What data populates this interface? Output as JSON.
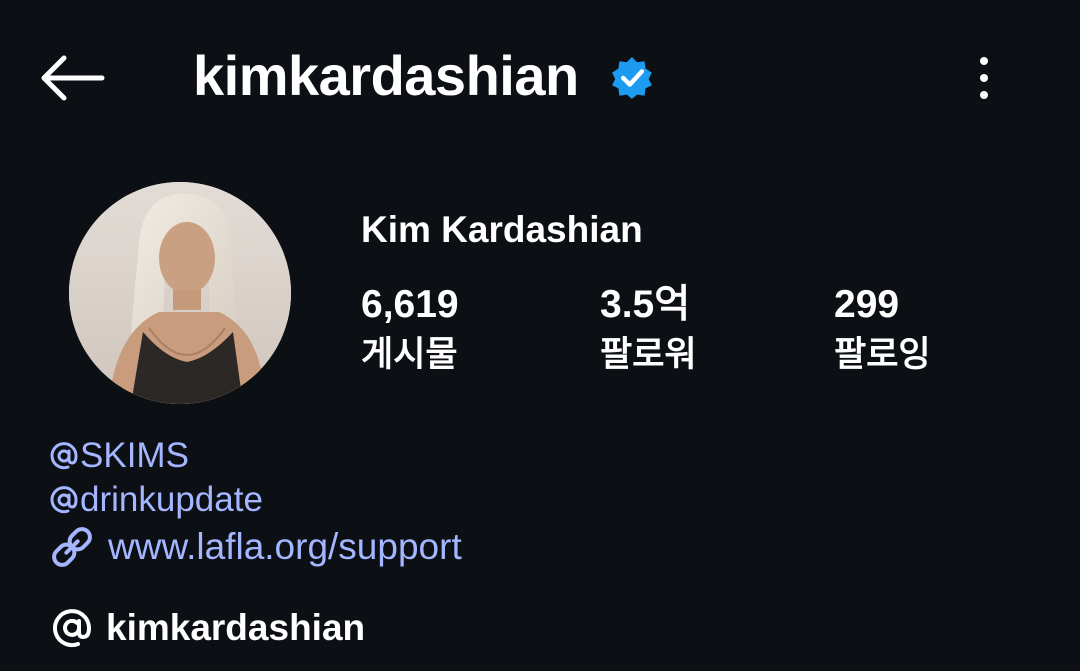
{
  "header": {
    "username": "kimkardashian",
    "back_icon": "arrow-left-icon",
    "verified_icon": "verified-badge-icon",
    "verified_color": "#1d9bf0",
    "more_icon": "more-vertical-icon"
  },
  "profile": {
    "display_name": "Kim Kardashian",
    "avatar": "profile-photo"
  },
  "stats": [
    {
      "value": "6,619",
      "label": "게시물"
    },
    {
      "value": "3.5억",
      "label": "팔로워"
    },
    {
      "value": "299",
      "label": "팔로잉"
    }
  ],
  "bio": {
    "mentions": [
      "SKIMS",
      "drinkupdate"
    ],
    "mention_icon": "threads-at-icon",
    "link": "www.lafla.org/support",
    "link_icon": "link-icon",
    "link_color": "#a3b6ff"
  },
  "threads": {
    "icon": "threads-icon",
    "username": "kimkardashian"
  }
}
